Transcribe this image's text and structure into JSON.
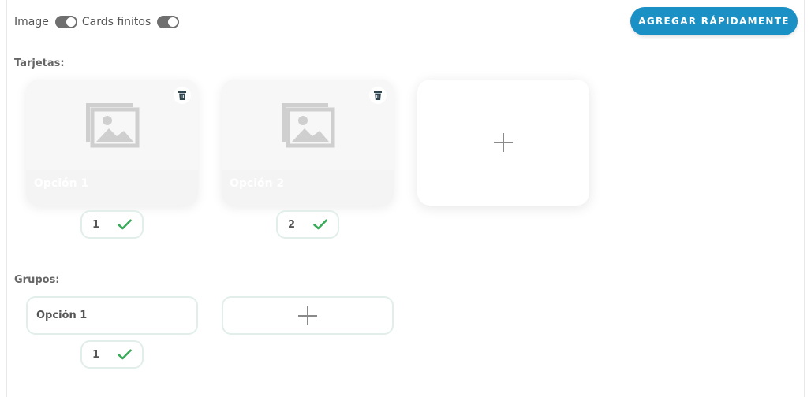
{
  "toolbar": {
    "image_label": "Image",
    "cards_finitos_label": "Cards finitos",
    "quick_add_label": "AGREGAR RÁPIDAMENTE"
  },
  "sections": {
    "cards_title": "Tarjetas:",
    "groups_title": "Grupos:"
  },
  "cards": [
    {
      "label": "Opción 1",
      "number": "1"
    },
    {
      "label": "Opción 2",
      "number": "2"
    }
  ],
  "groups": [
    {
      "label": "Opción 1",
      "number": "1"
    }
  ],
  "icons": {
    "image_placeholder": "image-icon",
    "delete": "trash-icon",
    "add": "plus-icon",
    "confirm": "check-icon"
  },
  "colors": {
    "accent": "#1a90c4",
    "check": "#3aaa5a",
    "toggle": "#6f6f6f"
  }
}
